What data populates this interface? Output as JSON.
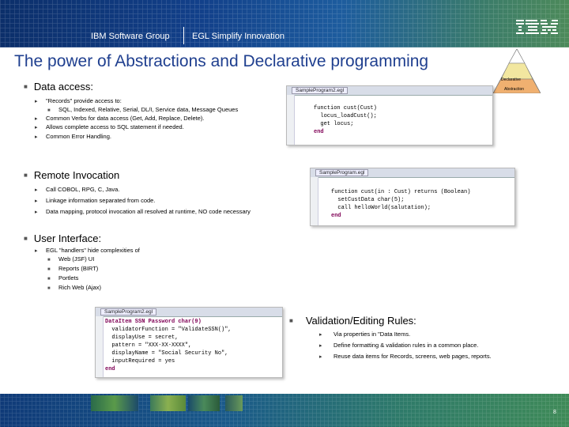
{
  "header": {
    "group": "IBM Software Group",
    "product": "EGL Simplify Innovation",
    "logo_text": "IBM"
  },
  "title": "The power of Abstractions and Declarative programming",
  "pyramid": {
    "top_label": "Declarative",
    "bottom_label": "Abstraction"
  },
  "sections": {
    "data_access": {
      "heading": "Data access:",
      "items": [
        "\"Records\" provide access to:",
        "Common Verbs for data access (Get, Add, Replace, Delete).",
        "Allows complete access to SQL statement if needed.",
        "Common Error Handling."
      ],
      "subitems": [
        "SQL, Indexed, Relative, Serial, DL/I, Service data, Message Queues"
      ]
    },
    "remote": {
      "heading": "Remote Invocation",
      "items": [
        "Call COBOL, RPG, C, Java.",
        "Linkage information separated from code.",
        "Data mapping, protocol invocation all resolved at runtime, NO code necessary"
      ]
    },
    "ui": {
      "heading": "User Interface:",
      "items": [
        "EGL \"handlers\" hide complexities of"
      ],
      "subitems": [
        "Web (JSF) UI",
        "Reports (BIRT)",
        "Portlets",
        "Rich Web (Ajax)"
      ]
    },
    "validation": {
      "heading": "Validation/Editing Rules:",
      "items": [
        "Via properties in \"Data Items.",
        "Define formatting & validation rules in a common place.",
        "Reuse data items for Records, screens, web pages, reports."
      ]
    }
  },
  "code_shots": {
    "shot1": {
      "tab": "SampleProgram2.egl",
      "lines": [
        "function cust(Cust)",
        "  locus_loadCust();",
        "  get locus;",
        "end"
      ]
    },
    "shot2": {
      "tab": "SampleProgram.egl",
      "lines": [
        "function cust(in : Cust) returns (Boolean)",
        "  setCustData char(5);",
        "  call helloWorld(salutation);",
        "end"
      ]
    },
    "shot3": {
      "tab": "SampleProgram2.egl",
      "lines": [
        "DataItem SSN Password char(9)",
        "  validatorFunction = \"ValidateSSN()\",",
        "  displayUse = secret,",
        "  pattern = \"XXX-XX-XXXX\",",
        "  displayName = \"Social Security No\",",
        "  inputRequired = yes",
        "end"
      ]
    }
  },
  "footer": {
    "page_number": "8"
  },
  "colors": {
    "title": "#1f3f8f",
    "header_dark": "#0c2f6a",
    "header_green": "#4d8a5a"
  }
}
